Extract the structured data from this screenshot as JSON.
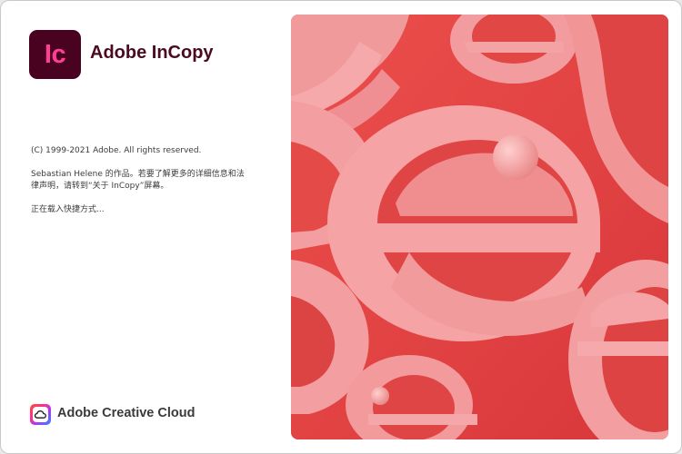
{
  "app": {
    "logo_text": "Ic",
    "name": "Adobe InCopy",
    "logo_bg": "#49021f",
    "logo_fg": "#ff3f94"
  },
  "info": {
    "copyright": "(C) 1999-2021 Adobe. All rights reserved.",
    "credits_line1": "Sebastian Helene 的作品。若要了解更多的详细信息和法",
    "credits_line2": "律声明，请转到“关于 InCopy”屏幕。",
    "loading": "正在载入快捷方式..."
  },
  "footer": {
    "brand": "Adobe Creative Cloud",
    "icon": "creative-cloud-icon"
  },
  "artwork": {
    "description_icon": "pink-letter-e-sculpture",
    "primary_color": "#e84646",
    "accent_color": "#f39c9f"
  }
}
